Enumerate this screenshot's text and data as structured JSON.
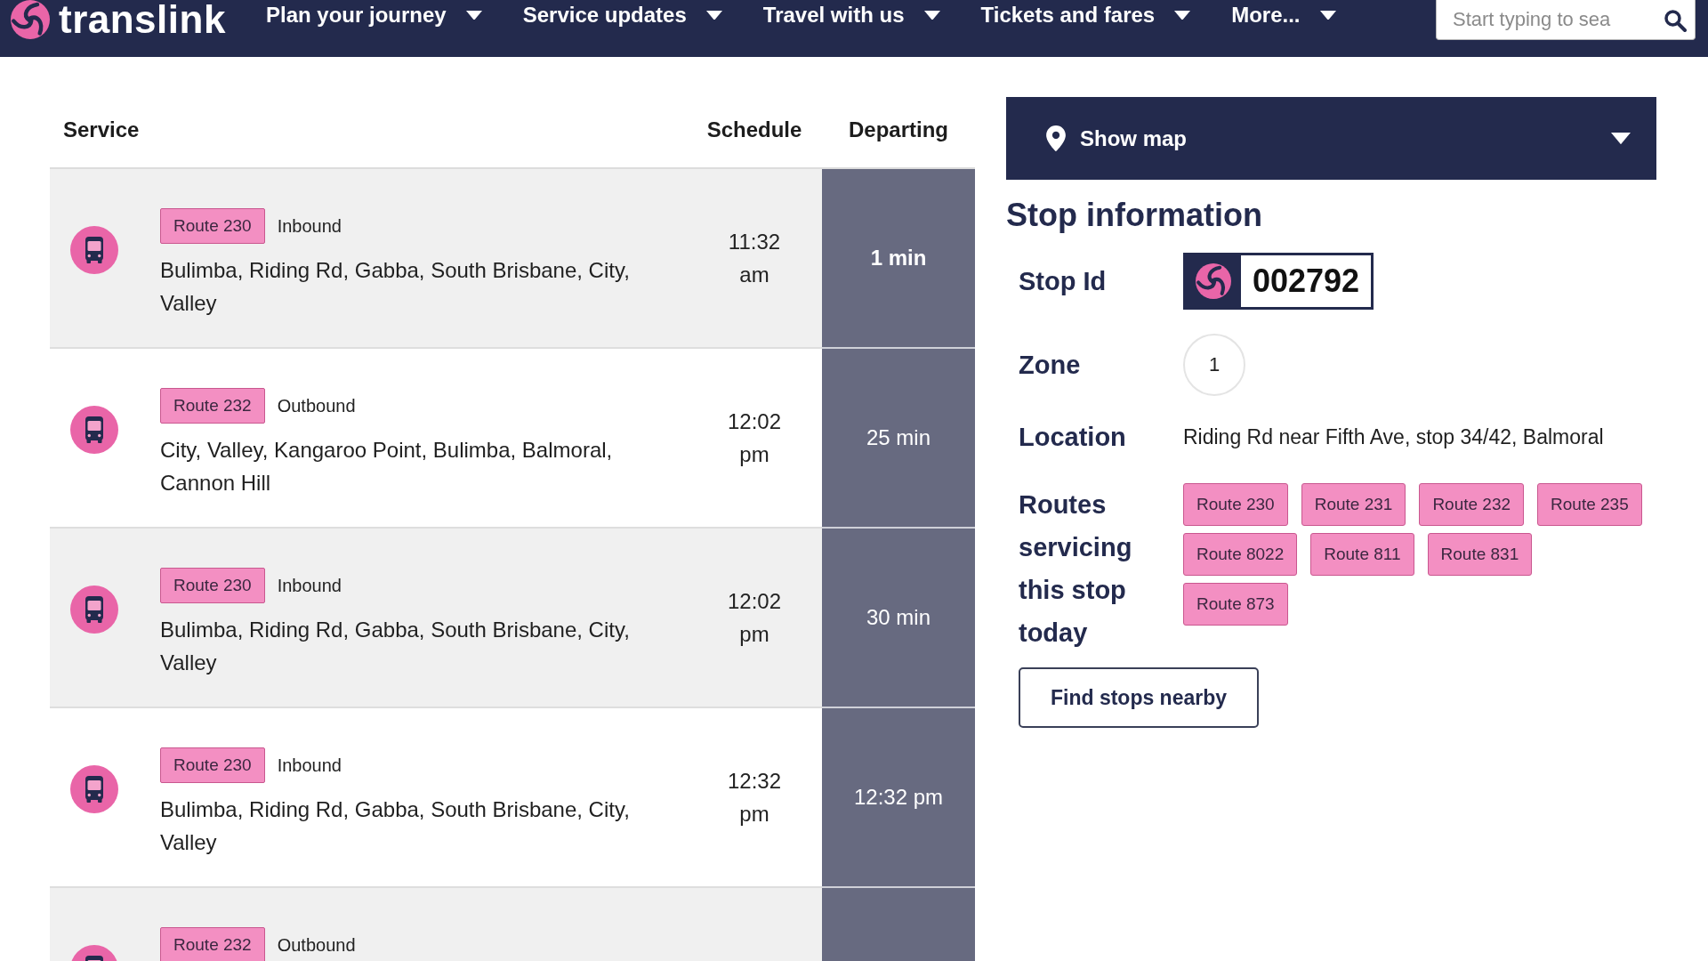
{
  "nav": {
    "brand": "translink",
    "items": [
      {
        "label": "Plan your journey"
      },
      {
        "label": "Service updates"
      },
      {
        "label": "Travel with us"
      },
      {
        "label": "Tickets and fares"
      },
      {
        "label": "More..."
      }
    ],
    "search": {
      "placeholder": "Start typing to sea"
    }
  },
  "departures": {
    "columns": [
      "Service",
      "Schedule",
      "Departing"
    ],
    "rows": [
      {
        "route": "Route 230",
        "direction": "Inbound",
        "stops": "Bulimba, Riding Rd, Gabba, South Brisbane, City, Valley",
        "schedule": "11:32 am",
        "departing": "1 min",
        "highlighted": true
      },
      {
        "route": "Route 232",
        "direction": "Outbound",
        "stops": "City, Valley, Kangaroo Point, Bulimba, Balmoral, Cannon Hill",
        "schedule": "12:02 pm",
        "departing": "25 min",
        "highlighted": false
      },
      {
        "route": "Route 230",
        "direction": "Inbound",
        "stops": "Bulimba, Riding Rd, Gabba, South Brisbane, City, Valley",
        "schedule": "12:02 pm",
        "departing": "30 min",
        "highlighted": false
      },
      {
        "route": "Route 230",
        "direction": "Inbound",
        "stops": "Bulimba, Riding Rd, Gabba, South Brisbane, City, Valley",
        "schedule": "12:32 pm",
        "departing": "12:32 pm",
        "highlighted": false
      },
      {
        "route": "Route 232",
        "direction": "Outbound"
      }
    ]
  },
  "map_toggle": {
    "label": "Show map",
    "expanded": false
  },
  "stop_info": {
    "title": "Stop information",
    "stop_id": {
      "label": "Stop Id",
      "value": "002792"
    },
    "zone": {
      "label": "Zone",
      "value": "1"
    },
    "location": {
      "label": "Location",
      "value": "Riding Rd near Fifth Ave, stop 34/42, Balmoral"
    },
    "routes": {
      "label": "Routes servicing this stop today",
      "items": [
        "Route 230",
        "Route 231",
        "Route 232",
        "Route 235",
        "Route 8022",
        "Route 811",
        "Route 831",
        "Route 873"
      ]
    },
    "button": "Find stops nearby"
  }
}
